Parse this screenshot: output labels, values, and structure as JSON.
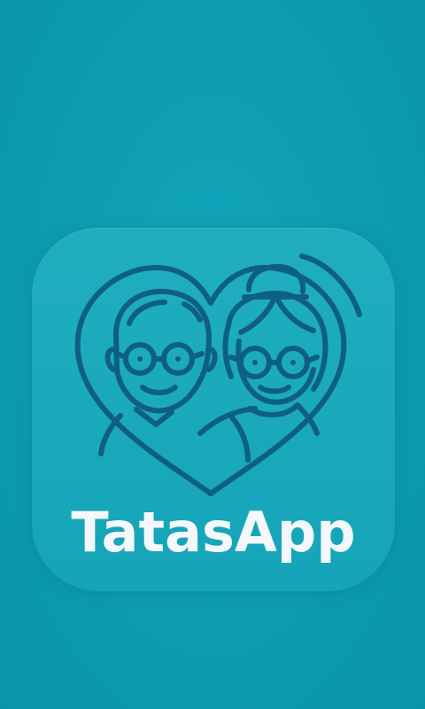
{
  "screen": "splash",
  "app": {
    "name": "TatasApp",
    "logo_icon": "grandparents-heart-icon"
  },
  "colors": {
    "background": "#0c9bb1",
    "icon_tile": "#1aa9bb",
    "line_art": "#0f5f80",
    "app_name_text": "#f4f8fa"
  }
}
